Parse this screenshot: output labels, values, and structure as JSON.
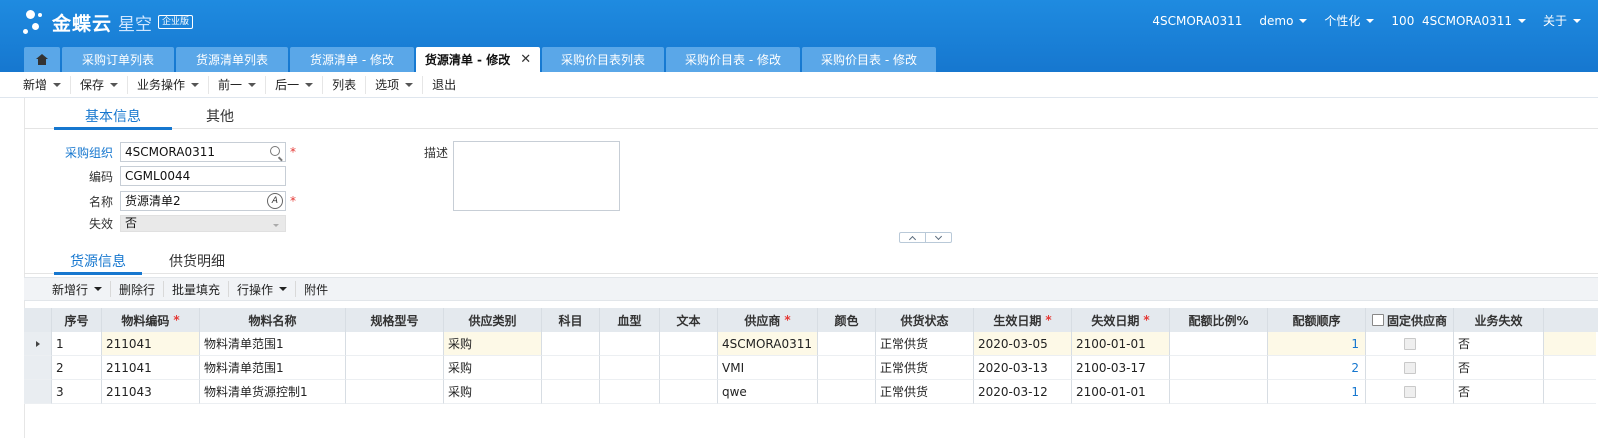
{
  "brand": {
    "name": "金蝶云",
    "product": "星空",
    "edition": "企业版"
  },
  "topnav": {
    "tenant": "4SCMORA0311",
    "user": "demo",
    "personalize": "个性化",
    "org": "100  4SCMORA0311",
    "about": "关于"
  },
  "tabs": [
    {
      "label": "采购订单列表",
      "active": false
    },
    {
      "label": "货源清单列表",
      "active": false
    },
    {
      "label": "货源清单 - 修改",
      "active": false
    },
    {
      "label": "货源清单 - 修改",
      "active": true
    },
    {
      "label": "采购价目表列表",
      "active": false
    },
    {
      "label": "采购价目表 - 修改",
      "active": false
    },
    {
      "label": "采购价目表 - 修改",
      "active": false
    }
  ],
  "toolbar": {
    "new": "新增",
    "save": "保存",
    "business": "业务操作",
    "prev": "前一",
    "next": "后一",
    "list": "列表",
    "options": "选项",
    "exit": "退出"
  },
  "header_tabs": {
    "basic": "基本信息",
    "other": "其他"
  },
  "form": {
    "purchase_org_label": "采购组织",
    "purchase_org": "4SCMORA0311",
    "code_label": "编码",
    "code": "CGML0044",
    "name_label": "名称",
    "name": "货源清单2",
    "invalid_label": "失效",
    "invalid": "否",
    "desc_label": "描述",
    "required_mark": "*"
  },
  "detail_tabs": {
    "source": "货源信息",
    "supply": "供货明细"
  },
  "grid_toolbar": {
    "add_row": "新增行",
    "delete_row": "删除行",
    "batch_fill": "批量填充",
    "row_ops": "行操作",
    "attachment": "附件"
  },
  "columns": {
    "seq": "序号",
    "material_code": "物料编码",
    "material_name": "物料名称",
    "spec": "规格型号",
    "supply_type": "供应类别",
    "subject": "科目",
    "blood": "血型",
    "text": "文本",
    "supplier": "供应商",
    "color": "颜色",
    "supply_status": "供货状态",
    "effective_date": "生效日期",
    "expiry_date": "失效日期",
    "quota_ratio": "配额比例%",
    "quota_order": "配额顺序",
    "fixed_supplier": "固定供应商",
    "biz_invalid": "业务失效"
  },
  "rows": [
    {
      "seq": "1",
      "material_code": "211041",
      "material_name": "物料清单范围1",
      "supply_type": "采购",
      "supplier": "4SCMORA0311",
      "supply_status": "正常供货",
      "effective_date": "2020-03-05",
      "expiry_date": "2100-01-01",
      "quota_order": "1",
      "biz_invalid": "否"
    },
    {
      "seq": "2",
      "material_code": "211041",
      "material_name": "物料清单范围1",
      "supply_type": "采购",
      "supplier": "VMI",
      "supply_status": "正常供货",
      "effective_date": "2020-03-13",
      "expiry_date": "2100-03-17",
      "quota_order": "2",
      "biz_invalid": "否"
    },
    {
      "seq": "3",
      "material_code": "211043",
      "material_name": "物料清单货源控制1",
      "supply_type": "采购",
      "supplier": "qwe",
      "supply_status": "正常供货",
      "effective_date": "2020-03-12",
      "expiry_date": "2100-01-01",
      "quota_order": "1",
      "biz_invalid": "否"
    }
  ]
}
